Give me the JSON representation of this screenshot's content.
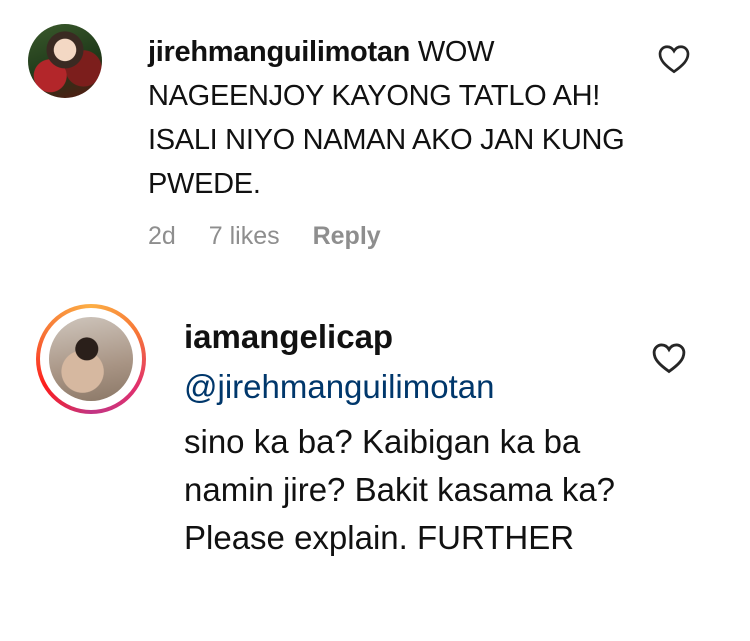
{
  "comments": [
    {
      "username": "jirehmanguilimotan",
      "text": "WOW NAGEENJOY KAYONG TATLO AH! ISALI NIYO NAMAN AKO JAN KUNG PWEDE.",
      "age": "2d",
      "likes": "7 likes",
      "reply_label": "Reply"
    },
    {
      "username": "iamangelicap",
      "mention": "@jirehmanguilimotan",
      "text": "sino ka ba? Kaibigan ka ba namin jire? Bakit kasama ka? Please explain. FURTHER"
    }
  ],
  "icons": {
    "like": "heart-outline-icon"
  },
  "colors": {
    "mention": "#00376b",
    "meta": "#8e8e8e"
  }
}
